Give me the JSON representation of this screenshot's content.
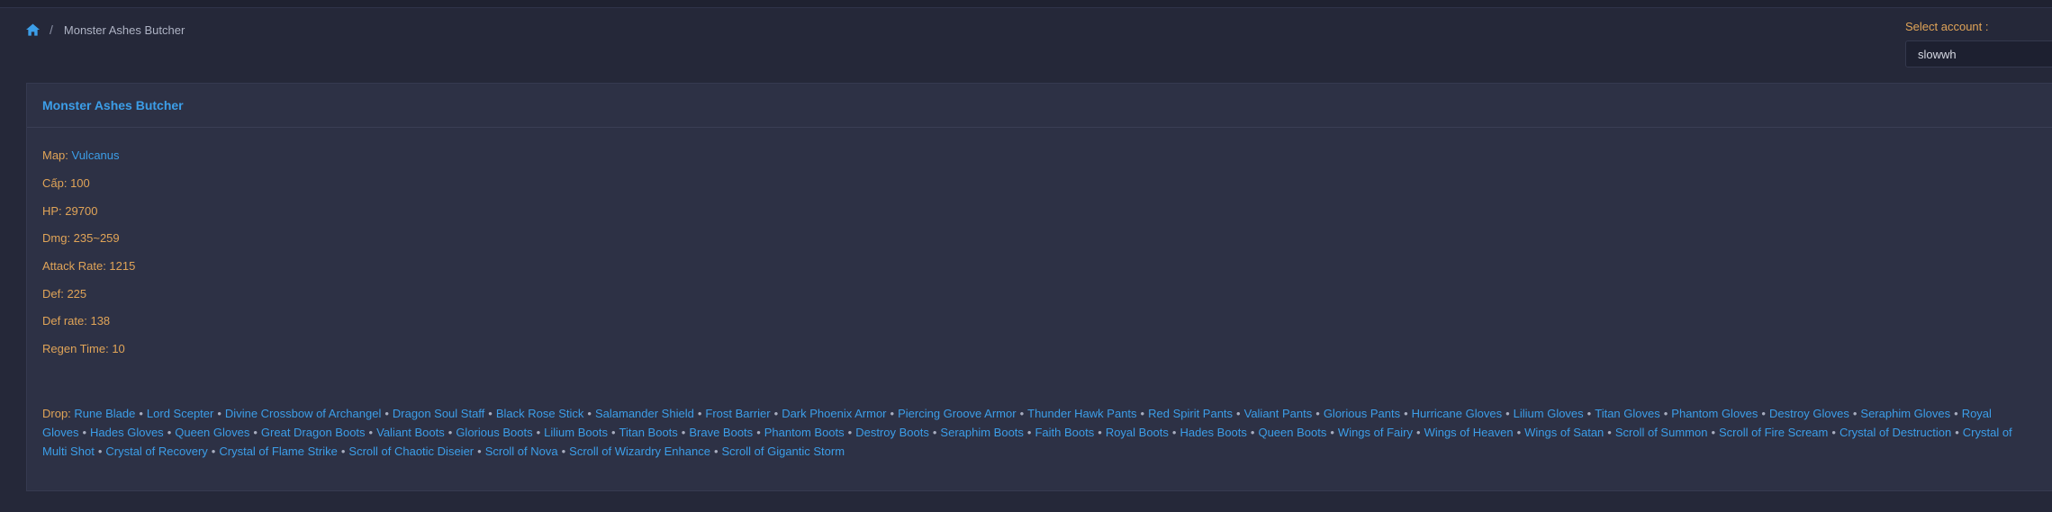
{
  "breadcrumb": {
    "home_icon": "home-icon",
    "separator": "/",
    "current": "Monster Ashes Butcher"
  },
  "account": {
    "label": "Select account :",
    "selected": "slowwh"
  },
  "panel": {
    "title": "Monster Ashes Butcher",
    "stats": [
      {
        "label": "Map: ",
        "value": "Vulcanus",
        "link": true
      },
      {
        "label": "Cấp: 100"
      },
      {
        "label": "HP: 29700"
      },
      {
        "label": "Dmg: 235~259"
      },
      {
        "label": "Attack Rate: 1215"
      },
      {
        "label": "Def: 225"
      },
      {
        "label": "Def rate: 138"
      },
      {
        "label": "Regen Time: 10"
      }
    ],
    "drop_label": "Drop: ",
    "drops": [
      "Rune Blade",
      "Lord Scepter",
      "Divine Crossbow of Archangel",
      "Dragon Soul Staff",
      "Black Rose Stick",
      "Salamander Shield",
      "Frost Barrier",
      "Dark Phoenix Armor",
      "Piercing Groove Armor",
      "Thunder Hawk Pants",
      "Red Spirit Pants",
      "Valiant Pants",
      "Glorious Pants",
      "Hurricane Gloves",
      "Lilium Gloves",
      "Titan Gloves",
      "Phantom Gloves",
      "Destroy Gloves",
      "Seraphim Gloves",
      "Royal Gloves",
      "Hades Gloves",
      "Queen Gloves",
      "Great Dragon Boots",
      "Valiant Boots",
      "Glorious Boots",
      "Lilium Boots",
      "Titan Boots",
      "Brave Boots",
      "Phantom Boots",
      "Destroy Boots",
      "Seraphim Boots",
      "Faith Boots",
      "Royal Boots",
      "Hades Boots",
      "Queen Boots",
      "Wings of Fairy",
      "Wings of Heaven",
      "Wings of Satan",
      "Scroll of Summon",
      "Scroll of Fire Scream",
      "Crystal of Destruction",
      "Crystal of Multi Shot",
      "Crystal of Recovery",
      "Crystal of Flame Strike",
      "Scroll of Chaotic Diseier",
      "Scroll of Nova",
      "Scroll of Wizardry Enhance",
      "Scroll of Gigantic Storm"
    ],
    "drop_separator": "•"
  },
  "colors": {
    "background": "#252839",
    "panel": "#2d3145",
    "link": "#3c9ee8",
    "label": "#e0a458"
  }
}
